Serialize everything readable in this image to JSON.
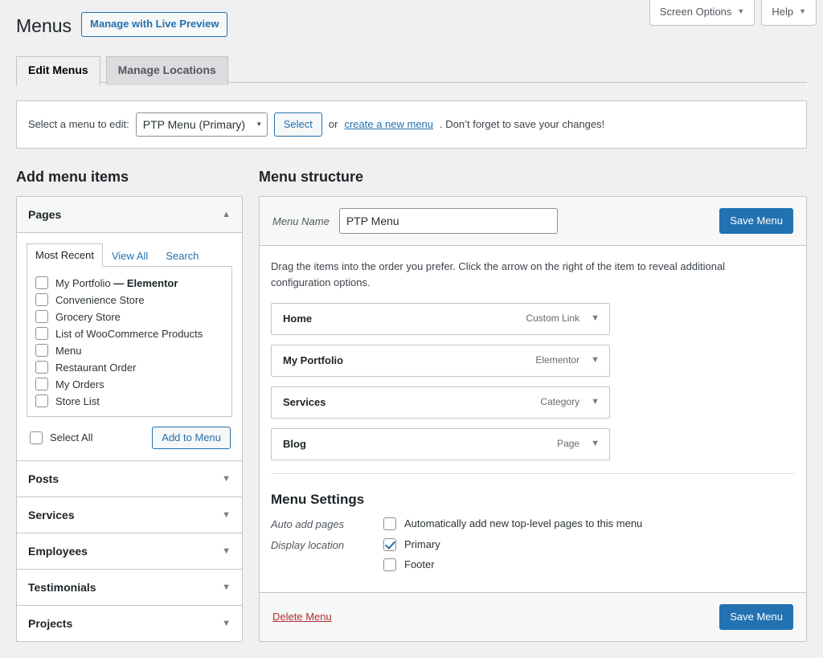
{
  "screen_meta": [
    {
      "label": "Screen Options",
      "caret": "▼"
    },
    {
      "label": "Help",
      "caret": "▼"
    }
  ],
  "header": {
    "title": "Menus",
    "action_label": "Manage with Live Preview"
  },
  "nav_tabs": [
    {
      "label": "Edit Menus",
      "active": true
    },
    {
      "label": "Manage Locations",
      "active": false
    }
  ],
  "menu_select_bar": {
    "label": "Select a menu to edit:",
    "selected_menu": "PTP Menu (Primary)",
    "options": [
      "PTP Menu (Primary)"
    ],
    "select_button": "Select",
    "or_text": "or",
    "create_link": "create a new menu",
    "tail_text": ". Don’t forget to save your changes!"
  },
  "left_column": {
    "heading": "Add menu items",
    "pages_panel": {
      "title": "Pages",
      "toggle_icon": "▲",
      "tabs": [
        {
          "label": "Most Recent",
          "active": true
        },
        {
          "label": "View All",
          "active": false
        },
        {
          "label": "Search",
          "active": false
        }
      ],
      "items": [
        {
          "label": "My Portfolio",
          "suffix": " — Elementor",
          "checked": false
        },
        {
          "label": "Convenience Store",
          "suffix": "",
          "checked": false
        },
        {
          "label": "Grocery Store",
          "suffix": "",
          "checked": false
        },
        {
          "label": "List of WooCommerce Products",
          "suffix": "",
          "checked": false
        },
        {
          "label": "Menu",
          "suffix": "",
          "checked": false
        },
        {
          "label": "Restaurant Order",
          "suffix": "",
          "checked": false
        },
        {
          "label": "My Orders",
          "suffix": "",
          "checked": false
        },
        {
          "label": "Store List",
          "suffix": "",
          "checked": false
        }
      ],
      "select_all_label": "Select All",
      "add_to_menu_label": "Add to Menu"
    },
    "collapsed_panels": [
      {
        "title": "Posts",
        "toggle_icon": "▼"
      },
      {
        "title": "Services",
        "toggle_icon": "▼"
      },
      {
        "title": "Employees",
        "toggle_icon": "▼"
      },
      {
        "title": "Testimonials",
        "toggle_icon": "▼"
      },
      {
        "title": "Projects",
        "toggle_icon": "▼"
      }
    ]
  },
  "right_column": {
    "heading": "Menu structure",
    "menu_name_label": "Menu Name",
    "menu_name_value": "PTP Menu",
    "menu_name_placeholder": "Menu Name",
    "save_menu_label": "Save Menu",
    "drag_help": "Drag the items into the order you prefer. Click the arrow on the right of the item to reveal additional configuration options.",
    "menu_items": [
      {
        "title": "Home",
        "type": "Custom Link",
        "arrow": "▼"
      },
      {
        "title": "My Portfolio",
        "type": "Elementor",
        "arrow": "▼"
      },
      {
        "title": "Services",
        "type": "Category",
        "arrow": "▼"
      },
      {
        "title": "Blog",
        "type": "Page",
        "arrow": "▼"
      }
    ],
    "settings": {
      "title": "Menu Settings",
      "auto_add_label": "Auto add pages",
      "auto_add_option": "Automatically add new top-level pages to this menu",
      "auto_add_checked": false,
      "display_location_label": "Display location",
      "locations": [
        {
          "label": "Primary",
          "checked": true
        },
        {
          "label": "Footer",
          "checked": false
        }
      ]
    },
    "footer": {
      "delete_label": "Delete Menu",
      "save_menu_label": "Save Menu"
    }
  },
  "colors": {
    "accent": "#2271b1",
    "danger": "#b32d2e",
    "page_bg": "#f0f0f1",
    "panel_border": "#c3c4c7"
  }
}
